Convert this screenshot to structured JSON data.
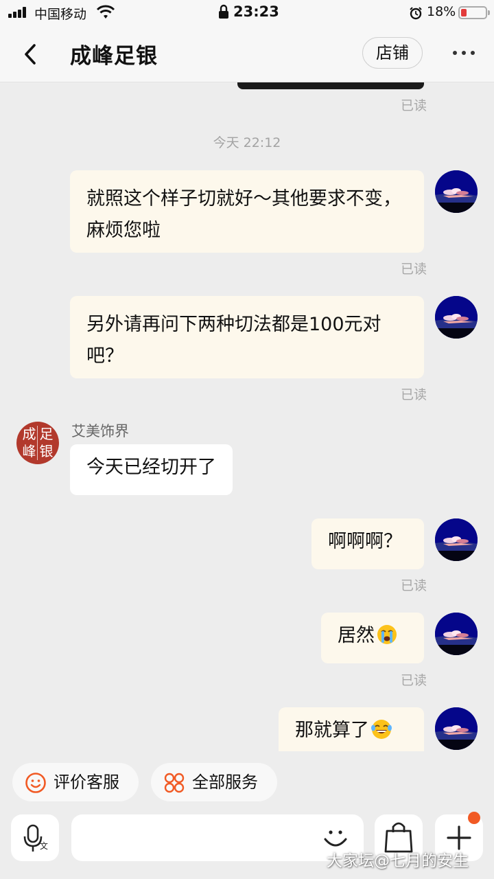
{
  "status_bar": {
    "carrier": "中国移动",
    "time": "23:23",
    "battery": "18%"
  },
  "header": {
    "title": "成峰足银",
    "store_label": "店铺"
  },
  "chat": {
    "read_label": "已读",
    "time_separator": "今天 22:12",
    "shop_sender": "艾美饰界",
    "shop_avatar_chars": [
      "成",
      "足",
      "峰",
      "银"
    ],
    "messages": [
      {
        "from": "me",
        "text": "就照这个样子切就好～其他要求不变，麻烦您啦"
      },
      {
        "from": "me",
        "text": "另外请再问下两种切法都是100元对吧？"
      },
      {
        "from": "shop",
        "text": "今天已经切开了"
      },
      {
        "from": "me",
        "text": "啊啊啊？"
      },
      {
        "from": "me",
        "text": "居然",
        "emoji": "crying-face"
      },
      {
        "from": "me",
        "text": "那就算了",
        "emoji": "tears-of-joy-face"
      }
    ]
  },
  "quick_actions": [
    {
      "label": "评价客服",
      "icon": "smiley-icon"
    },
    {
      "label": "全部服务",
      "icon": "services-grid-icon"
    }
  ],
  "watermark": "大家坛@七月的安生",
  "colors": {
    "accent": "#f15a24",
    "my_bubble": "#fdf8ec",
    "shop_bubble": "#ffffff",
    "avatar_blue": "#05068a",
    "shop_red": "#b2392c"
  }
}
